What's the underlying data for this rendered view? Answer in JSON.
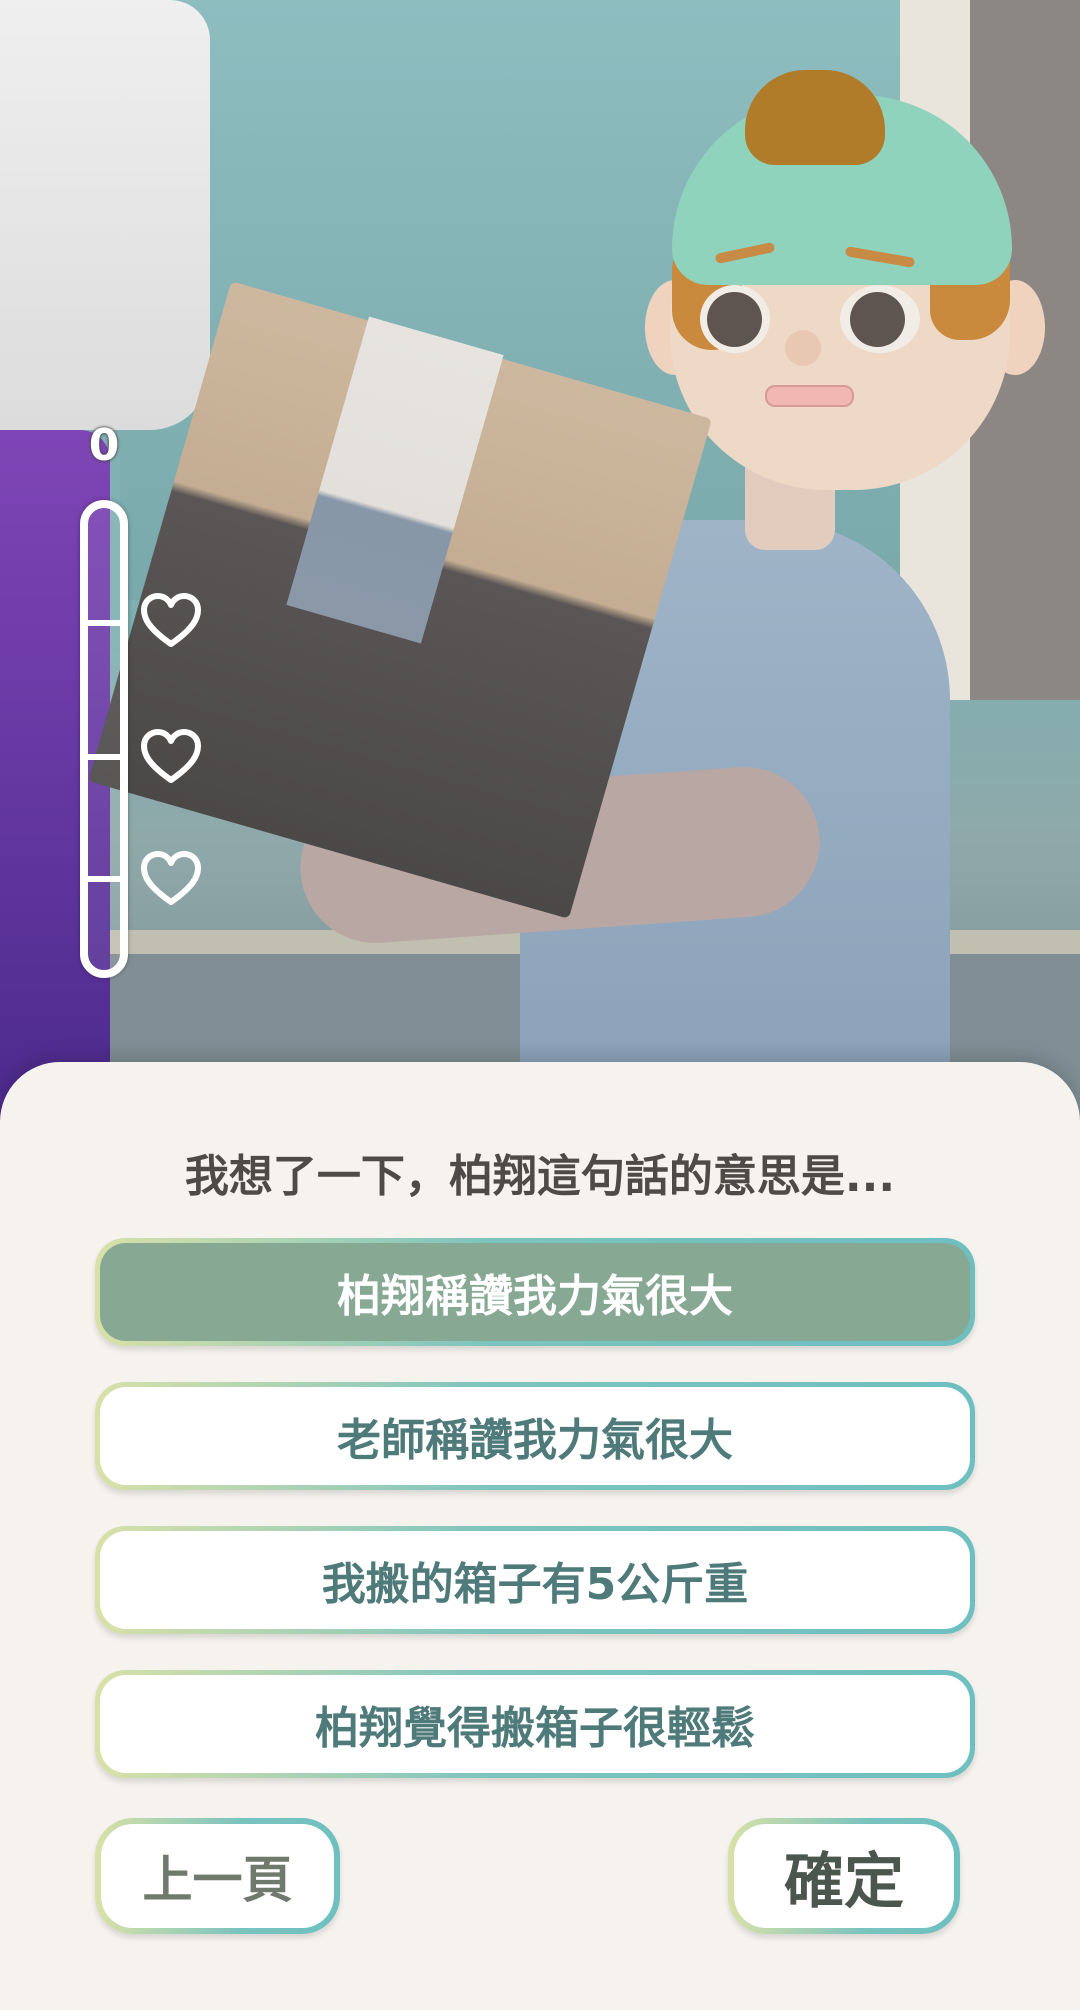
{
  "meter": {
    "value": "0",
    "hearts": [
      "heart-outline",
      "heart-outline",
      "heart-outline"
    ],
    "fill_fraction": 0
  },
  "dialog": {
    "question": "我想了一下，柏翔這句話的意思是...",
    "options": [
      {
        "label": "柏翔稱讚我力氣很大",
        "selected": true
      },
      {
        "label": "老師稱讚我力氣很大",
        "selected": false
      },
      {
        "label": "我搬的箱子有5公斤重",
        "selected": false
      },
      {
        "label": "柏翔覺得搬箱子很輕鬆",
        "selected": false
      }
    ],
    "prev_label": "上一頁",
    "confirm_label": "確定"
  },
  "colors": {
    "selected_option": "#87a893",
    "option_text": "#4f7a7a",
    "panel_bg": "#f6f3ef",
    "border_gradient_start": "#d9e1a8",
    "border_gradient_end": "#6ebfc0"
  }
}
